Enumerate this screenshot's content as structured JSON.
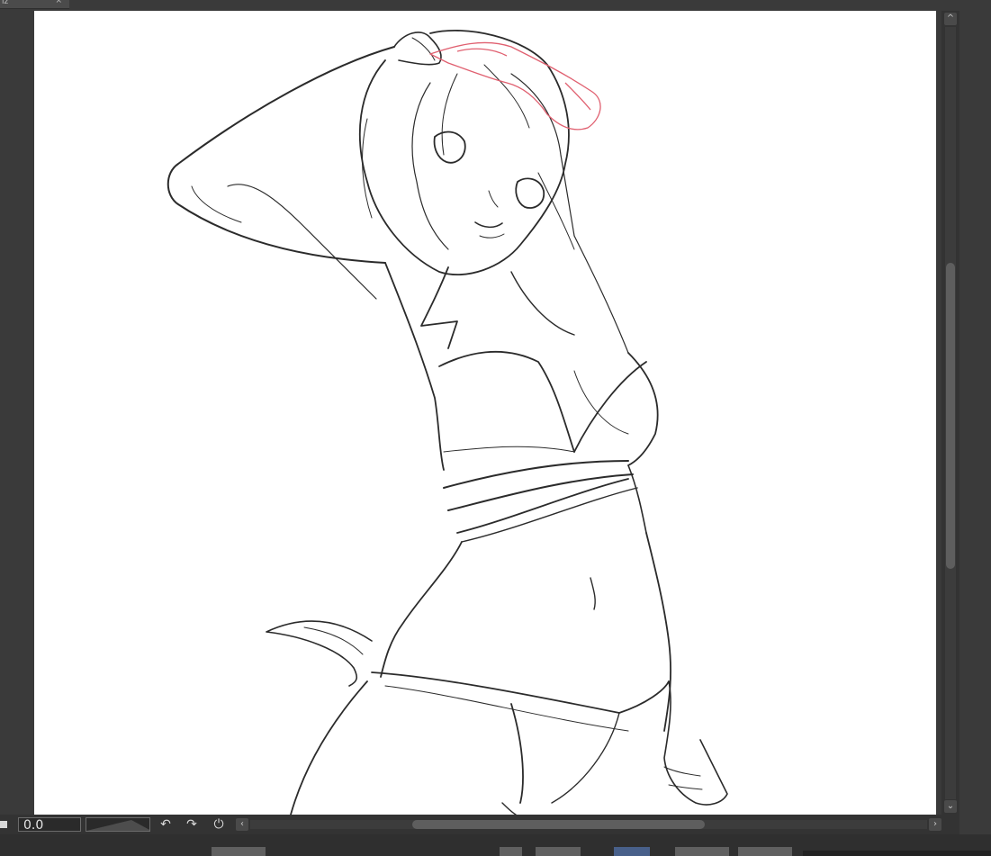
{
  "document_tab": {
    "label": "iz",
    "close": "×"
  },
  "canvas": {
    "background": "#ffffff",
    "line_color": "#2b2b2b",
    "sketch_color": "#e06070"
  },
  "bottom_bar": {
    "rotation_value": "0.0",
    "rotate_left_icon": "↶",
    "rotate_right_icon": "↷",
    "reset_rotation_icon": "⏻",
    "scroll_left_icon": "‹",
    "scroll_right_icon": "›"
  },
  "vertical_scroll": {
    "up_icon": "^",
    "down_icon": "⌄"
  }
}
